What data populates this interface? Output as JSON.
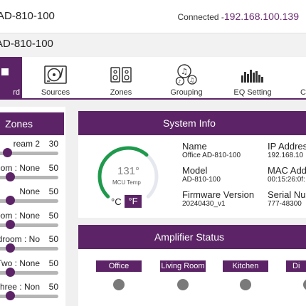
{
  "header": {
    "device_title": "AD-810-100",
    "connection_label": "Connected -",
    "ip": "192.168.100.139"
  },
  "subheader": {
    "title": "AD-810-100"
  },
  "nav": {
    "items": [
      {
        "label": "rd",
        "icon": "dashboard-icon"
      },
      {
        "label": "Sources",
        "icon": "turntable-icon"
      },
      {
        "label": "Zones",
        "icon": "speakers-icon"
      },
      {
        "label": "Grouping",
        "icon": "music-notes-icon"
      },
      {
        "label": "EQ Setting",
        "icon": "equalizer-icon"
      },
      {
        "label": "C",
        "icon": "cog-icon"
      }
    ]
  },
  "zones": {
    "title": "Zones",
    "items": [
      {
        "name": "ream 2",
        "value": "30",
        "level": 0.3
      },
      {
        "name": "om : None",
        "value": "50",
        "level": 0.5
      },
      {
        "name": "None",
        "value": "50",
        "level": 0.5
      },
      {
        "name": "room : None",
        "value": "50",
        "level": 0.5
      },
      {
        "name": "edroom : No",
        "value": "50",
        "level": 0.5
      },
      {
        "name": "Two : None",
        "value": "50",
        "level": 0.5
      },
      {
        "name": "Three : Non",
        "value": "50",
        "level": 0.5
      }
    ]
  },
  "system_info": {
    "title": "System Info",
    "temperature": "131°",
    "temperature_label": "MCU Temp",
    "temperature_fraction": 0.65,
    "unit_c": "°C",
    "unit_f": "°F",
    "gauge_color": "#1f9a4c",
    "name_label": "Name",
    "name_value": "Office AD-810-100",
    "model_label": "Model",
    "model_value": "AD-810-100",
    "firmware_label": "Firmware Version",
    "firmware_value": "20240430_v1",
    "ip_label": "IP Addres",
    "ip_value": "192.168.10",
    "mac_label": "MAC Add",
    "mac_value": "00:15:26:0f:",
    "serial_label": "Serial Nu",
    "serial_value": "777-48300"
  },
  "amplifier": {
    "title": "Amplifier Status",
    "zones": [
      {
        "label": "Office"
      },
      {
        "label": "Living Room"
      },
      {
        "label": "Kitchen"
      },
      {
        "label": "Di"
      }
    ]
  },
  "colors": {
    "accent": "#5c2466",
    "status_off": "#7a7a7a"
  }
}
